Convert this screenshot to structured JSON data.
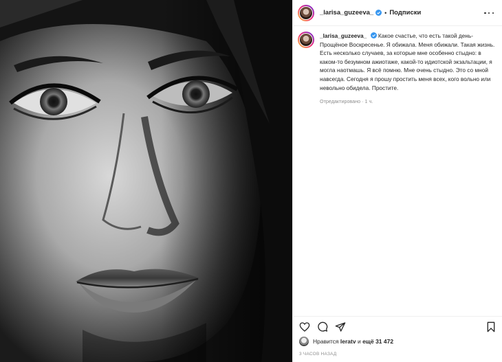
{
  "post": {
    "username": "_larisa_guzeeva_",
    "header_separator": "•",
    "follow_label": "Подписки",
    "caption_text": "Какое счастье, что есть такой день- Прощёное Воскресенье. Я обижала. Меня обижали. Такая жизнь. Есть несколько случаев, за которые мне особенно стыдно: в каком-то безумном ажиотаже, какой-то идиотской экзальтации, я могла наотмашь. Я всё помню. Мне очень стыдно. Это со мной навсегда. Сегодня я прошу простить меня всех, кого вольно или невольно обидела. Простите.",
    "caption_meta": "Отредактировано · 1 ч.",
    "likes_prefix": "Нравится",
    "likes_user": "leratv",
    "likes_middle": "и",
    "likes_rest": "ещё 31 472",
    "time_ago": "3 ЧАСОВ НАЗАД"
  },
  "icons": {
    "verified": "verified-badge-icon",
    "more": "more-options-icon",
    "like": "heart-icon",
    "comment": "comment-icon",
    "share": "share-icon",
    "save": "bookmark-icon"
  },
  "colors": {
    "verified": "#3897f0",
    "text": "#262626",
    "muted": "#8e8e8e",
    "divider": "#efefef"
  }
}
